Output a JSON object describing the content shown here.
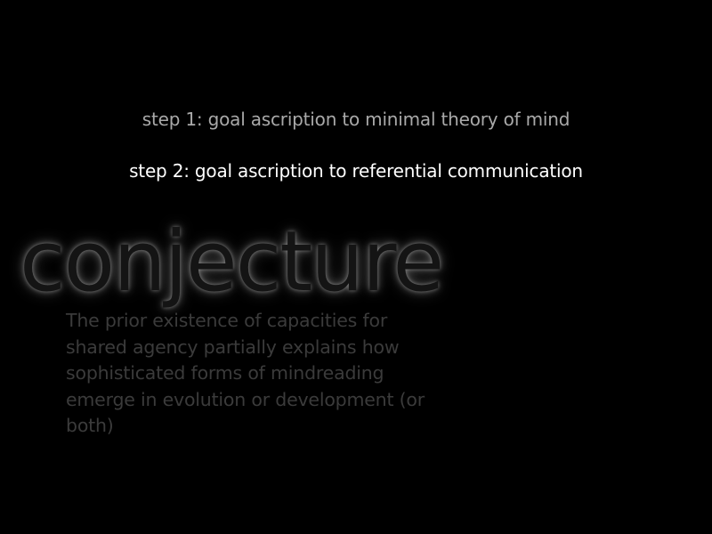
{
  "steps": [
    {
      "label": "step 1: goal ascription to minimal theory of mind",
      "color": "#a9a9a9"
    },
    {
      "label": "step 2: goal ascription to referential communication",
      "color": "#ffffff"
    }
  ],
  "conjecture": {
    "heading": "conjecture",
    "body": "The prior existence of capacities for shared agency partially explains how sophisticated forms of mindreading emerge in evolution or development (or both)"
  },
  "colors": {
    "background": "#000000",
    "heading_fill": "#141414",
    "body_text": "#3b3b3b"
  }
}
